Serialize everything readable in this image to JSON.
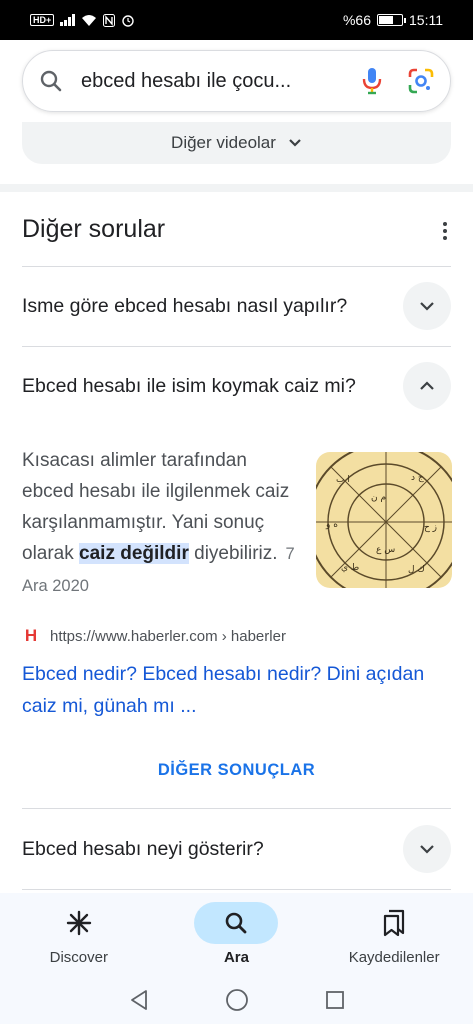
{
  "status_bar": {
    "hd_badge": "HD+",
    "battery_text": "%66",
    "battery_level": 0.66,
    "time": "15:11"
  },
  "search": {
    "query": "ebced hesabı ile çocu..."
  },
  "videos": {
    "more_label": "Diğer videolar"
  },
  "paa": {
    "title": "Diğer sorular",
    "questions": [
      {
        "text": "Isme göre ebced hesabı nasıl yapılır?",
        "expanded": false
      },
      {
        "text": "Ebced hesabı ile isim koymak caiz mi?",
        "expanded": true
      },
      {
        "text": "Ebced hesabı neyi gösterir?",
        "expanded": false
      }
    ],
    "answer": {
      "text_before": "Kısacası alimler tarafından ebced hesabı ile ilgilenmek caiz karşılanmamıştır. Yani sonuç olarak ",
      "highlight": "caiz değildir",
      "text_after": " diyebiliriz.",
      "date": "7 Ara 2020",
      "source_logo": "H",
      "source_url": "https://www.haberler.com › haberler",
      "link_title": "Ebced nedir? Ebced hesabı nedir? Dini açıdan caiz mi, günah mı ..."
    },
    "more_results": "DİĞER SONUÇLAR"
  },
  "bottom_nav": {
    "items": [
      {
        "label": "Discover",
        "icon": "asterisk-icon"
      },
      {
        "label": "Ara",
        "icon": "search-icon"
      },
      {
        "label": "Kaydedilenler",
        "icon": "bookmarks-icon"
      }
    ],
    "active": "Ara"
  },
  "colors": {
    "link": "#1558d6",
    "accent": "#1a73e8",
    "active_pill": "#c2e7ff",
    "highlight": "#d3e3fd"
  }
}
